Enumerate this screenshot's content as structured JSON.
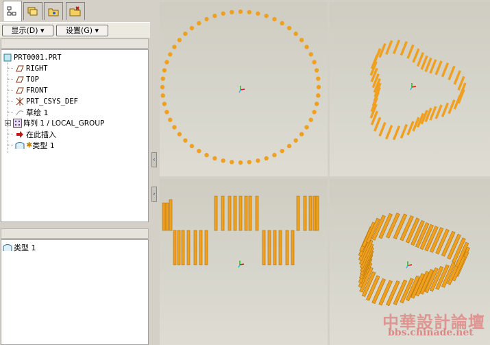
{
  "left_panel": {
    "tabs": [
      {
        "icon": "model-tree-icon",
        "active": true
      },
      {
        "icon": "layers-icon",
        "active": false
      },
      {
        "icon": "folder-icon",
        "active": false
      },
      {
        "icon": "favorites-icon",
        "active": false
      }
    ],
    "toolbar": {
      "display_label": "显示(D)",
      "settings_label": "设置(G)"
    },
    "tree": [
      {
        "label": "PRT0001.PRT",
        "icon": "part-icon"
      },
      {
        "label": "RIGHT",
        "icon": "datum-plane-icon"
      },
      {
        "label": "TOP",
        "icon": "datum-plane-icon"
      },
      {
        "label": "FRONT",
        "icon": "datum-plane-icon"
      },
      {
        "label": "PRT_CSYS_DEF",
        "icon": "csys-icon"
      },
      {
        "label": "草绘 1",
        "icon": "sketch-icon"
      },
      {
        "label": "阵列 1 / LOCAL_GROUP",
        "icon": "pattern-icon"
      },
      {
        "label": "在此插入",
        "icon": "insert-here-arrow-icon"
      },
      {
        "label": "类型 1",
        "icon": "quilt-icon"
      }
    ],
    "lower_panel": {
      "items": [
        {
          "label": "类型 1",
          "icon": "quilt-icon"
        }
      ]
    }
  },
  "viewports": [
    {
      "name": "front-view",
      "content": "circle of points"
    },
    {
      "name": "top-right-view",
      "content": "pattern of pins"
    },
    {
      "name": "side-view",
      "content": "pattern of pins"
    },
    {
      "name": "isometric-view",
      "content": "pattern of pins"
    }
  ],
  "colors": {
    "feature_orange": "#f0a020",
    "pin_dark": "#b87808",
    "viewport_bg": "#d4d2c8"
  },
  "watermark": {
    "main": "中華設計論壇",
    "url": "bbs.chinade.net"
  }
}
